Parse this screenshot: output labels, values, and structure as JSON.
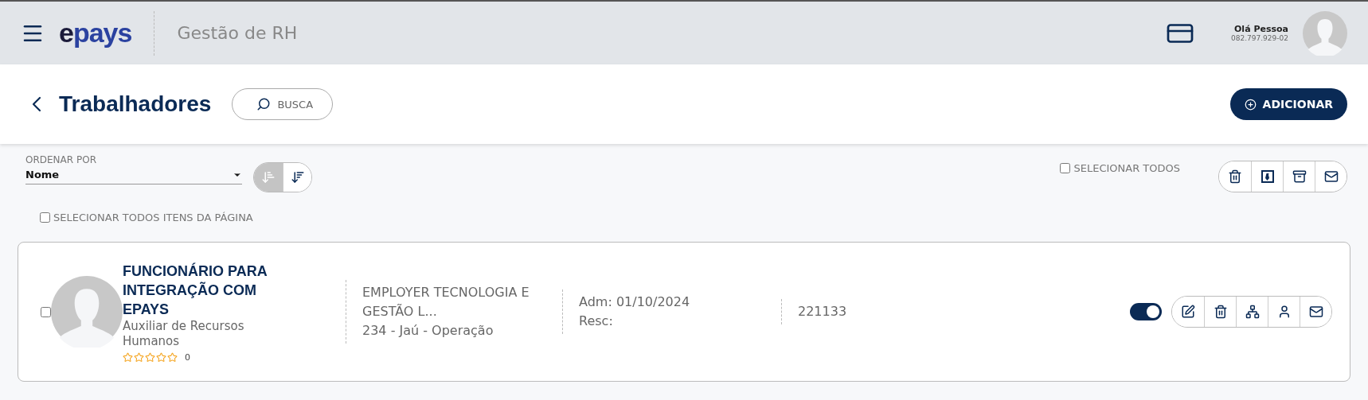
{
  "topbar": {
    "logo": "epays",
    "app_title": "Gestão de RH",
    "user": {
      "greeting": "Olá Pessoa",
      "document": "082.797.929-02"
    }
  },
  "header": {
    "title": "Trabalhadores",
    "search_label": "BUSCA",
    "add_label": "ADICIONAR"
  },
  "sort": {
    "label": "ORDENAR POR",
    "value": "Nome",
    "options": [
      {
        "kind": "ascending",
        "selected": true
      },
      {
        "kind": "descending",
        "selected": false
      }
    ]
  },
  "select_all": {
    "label": "SELECIONAR TODOS",
    "checked": false
  },
  "bulk_actions": [
    {
      "kind": "delete"
    },
    {
      "kind": "export"
    },
    {
      "kind": "archive"
    },
    {
      "kind": "email"
    }
  ],
  "select_page": {
    "label": "SELECIONAR TODOS ITENS DA PÁGINA",
    "checked": false
  },
  "workers": [
    {
      "checked": false,
      "name": "FUNCIONÁRIO PARA INTEGRAÇÃO COM EPAYS",
      "role": "Auxiliar de Recursos Humanos",
      "stars": 0,
      "rating_count": "0",
      "company": "EMPLOYER TECNOLOGIA E GESTÃO L...",
      "unit": "234 - Jaú - Operação",
      "admission": "Adm: 01/10/2024",
      "termination": "Resc:",
      "code": "221133",
      "active": true,
      "actions": [
        {
          "kind": "edit"
        },
        {
          "kind": "delete"
        },
        {
          "kind": "org"
        },
        {
          "kind": "profile"
        },
        {
          "kind": "email"
        }
      ]
    }
  ]
}
